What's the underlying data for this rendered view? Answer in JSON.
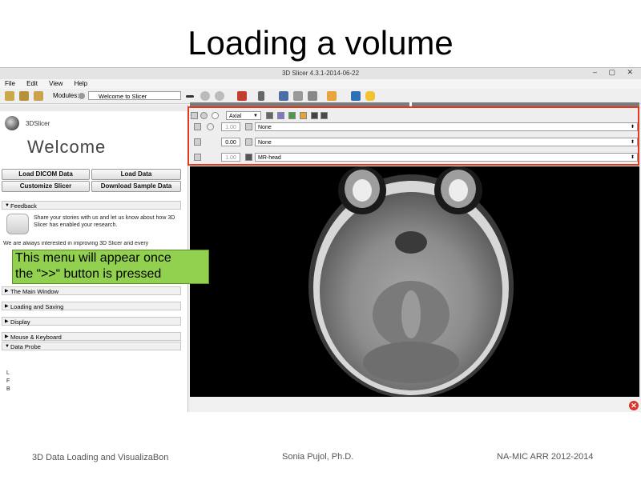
{
  "slide": {
    "title": "Loading a volume",
    "footer_left": "3D Data Loading and VisualizaBon",
    "footer_center": "Sonia Pujol, Ph.D.",
    "footer_right": "NA-MIC ARR 2012-2014"
  },
  "window": {
    "title": "3D Slicer 4.3.1-2014-06-22",
    "controls": "– ▢ ✕"
  },
  "menubar": [
    "File",
    "Edit",
    "View",
    "Help"
  ],
  "toolbar": {
    "modules_label": "Modules:",
    "module_selected": "Welcome to Slicer"
  },
  "module_panel": {
    "logo_text": "3DSlicer",
    "welcome_title": "Welcome",
    "buttons": {
      "load_dicom": "Load DICOM Data",
      "load_data": "Load Data",
      "customize": "Customize Slicer",
      "download_sample": "Download Sample Data"
    },
    "feedback_header": "Feedback",
    "feedback_text": "Share your stories with us and let us know about how 3D Slicer has enabled your research.",
    "interested_text": "We are always interested in improving 3D Slicer and every",
    "sections": [
      "The Main Window",
      "Loading and Saving",
      "Display",
      "Mouse & Keyboard",
      "Data Probe"
    ],
    "orientation": [
      "L",
      "F",
      "B"
    ]
  },
  "callout": {
    "line1": "This menu will appear once",
    "line2": "the “>>“ button is pressed"
  },
  "slice_controller": {
    "orientation": "Axial",
    "rows": [
      {
        "value": "1.00",
        "volume": "None"
      },
      {
        "value": "0.00",
        "volume": "None"
      },
      {
        "value": "1.00",
        "volume": "MR-head"
      }
    ]
  },
  "colors": {
    "highlight_border": "#e23a1a",
    "callout_bg": "#92d050",
    "viewer_bg": "#000000"
  }
}
